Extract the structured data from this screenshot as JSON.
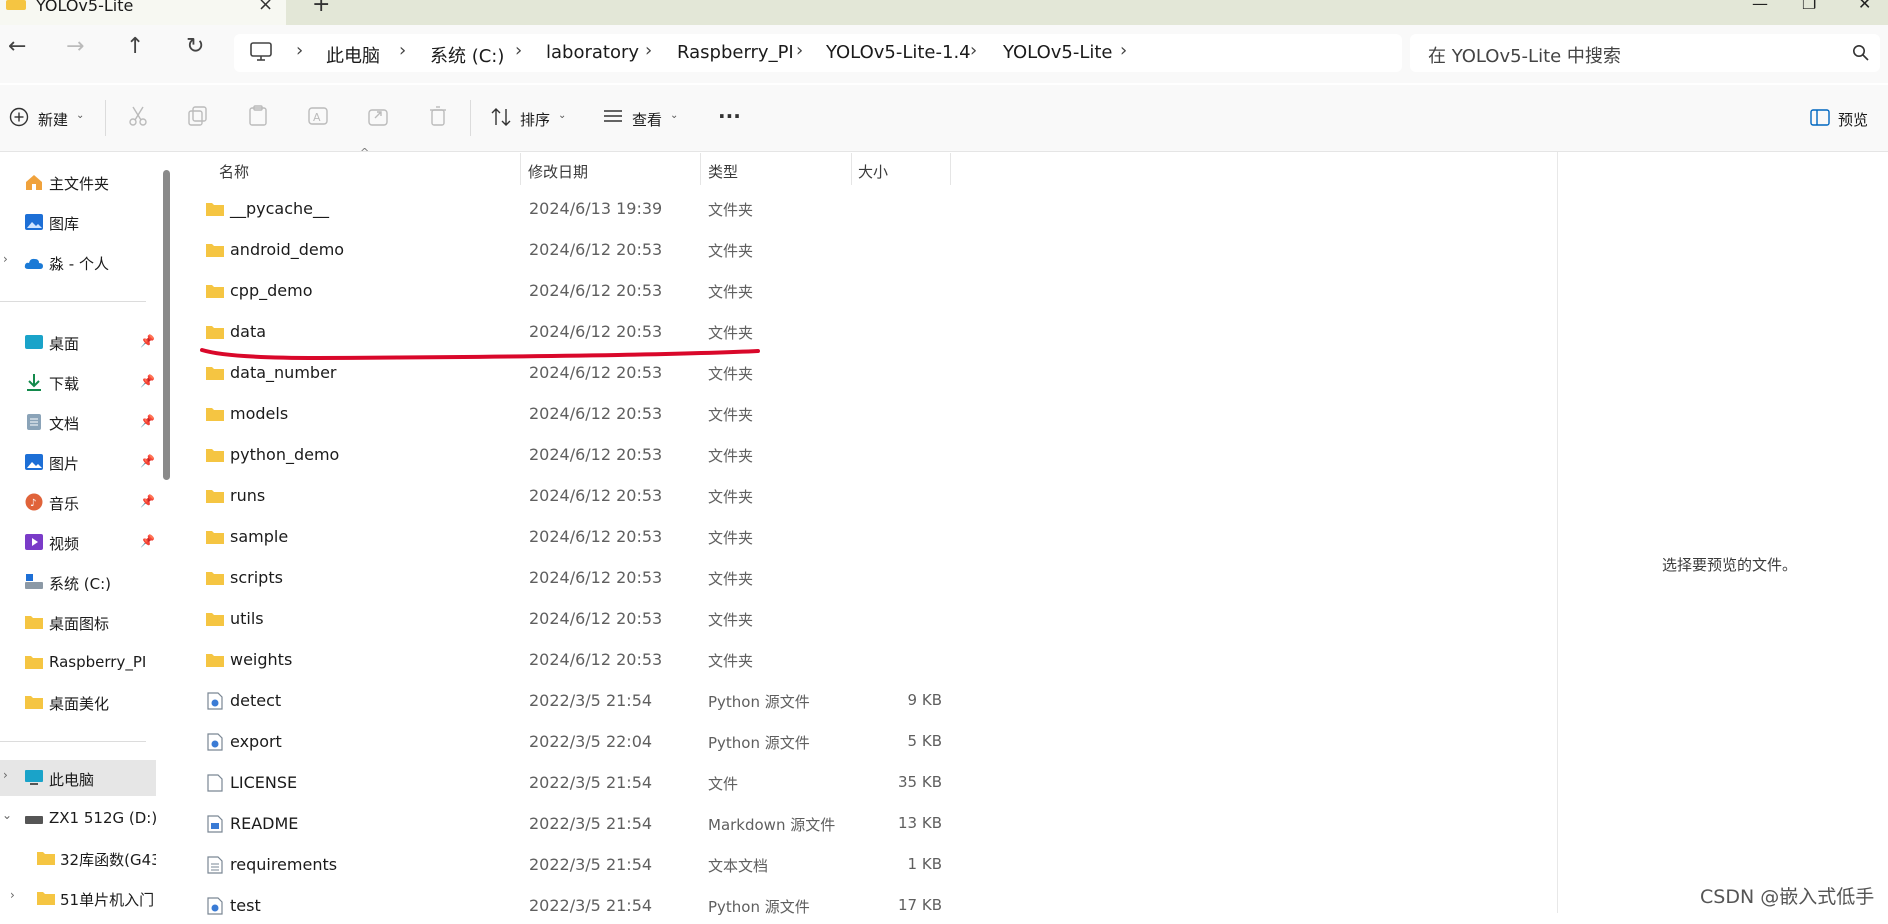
{
  "window": {
    "tab_title": "YOLOv5-Lite",
    "close_tab_symbol": "×",
    "new_tab_symbol": "+",
    "win_minimize": "—",
    "win_restore": "❐",
    "win_close": "✕"
  },
  "nav": {
    "back": "←",
    "forward": "→",
    "up": "↑",
    "refresh": "↻",
    "breadcrumbs": [
      "此电脑",
      "系统 (C:)",
      "laboratory",
      "Raspberry_PI",
      "YOLOv5-Lite-1.4",
      "YOLOv5-Lite"
    ],
    "sep": "›",
    "search_placeholder": "在 YOLOv5-Lite 中搜索"
  },
  "commandbar": {
    "new_label": "新建",
    "sort_label": "排序",
    "view_label": "查看",
    "more_label": "···",
    "preview_label": "预览"
  },
  "sidebar": {
    "quick": [
      {
        "label": "主文件夹",
        "icon": "home-icon"
      },
      {
        "label": "图库",
        "icon": "gallery-icon"
      },
      {
        "label": "淼 - 个人",
        "icon": "onedrive-icon"
      }
    ],
    "pinned": [
      {
        "label": "桌面",
        "icon": "desktop-icon"
      },
      {
        "label": "下载",
        "icon": "download-icon"
      },
      {
        "label": "文档",
        "icon": "document-icon"
      },
      {
        "label": "图片",
        "icon": "picture-icon"
      },
      {
        "label": "音乐",
        "icon": "music-icon"
      },
      {
        "label": "视频",
        "icon": "video-icon"
      }
    ],
    "folders": [
      {
        "label": "系统 (C:)",
        "icon": "drive-icon"
      },
      {
        "label": "桌面图标",
        "icon": "folder-icon"
      },
      {
        "label": "Raspberry_PI",
        "icon": "folder-icon"
      },
      {
        "label": "桌面美化",
        "icon": "folder-icon"
      }
    ],
    "this_pc": "此电脑",
    "drive_d": "ZX1 512G (D:)",
    "sub1": "32库函数(G43",
    "sub2": "51单片机入门"
  },
  "columns": {
    "name": "名称",
    "date": "修改日期",
    "type": "类型",
    "size": "大小"
  },
  "files": [
    {
      "name": "__pycache__",
      "date": "2024/6/13 19:39",
      "type": "文件夹",
      "size": "",
      "icon": "folder-icon"
    },
    {
      "name": "android_demo",
      "date": "2024/6/12 20:53",
      "type": "文件夹",
      "size": "",
      "icon": "folder-icon"
    },
    {
      "name": "cpp_demo",
      "date": "2024/6/12 20:53",
      "type": "文件夹",
      "size": "",
      "icon": "folder-icon"
    },
    {
      "name": "data",
      "date": "2024/6/12 20:53",
      "type": "文件夹",
      "size": "",
      "icon": "folder-icon"
    },
    {
      "name": "data_number",
      "date": "2024/6/12 20:53",
      "type": "文件夹",
      "size": "",
      "icon": "folder-icon"
    },
    {
      "name": "models",
      "date": "2024/6/12 20:53",
      "type": "文件夹",
      "size": "",
      "icon": "folder-icon"
    },
    {
      "name": "python_demo",
      "date": "2024/6/12 20:53",
      "type": "文件夹",
      "size": "",
      "icon": "folder-icon"
    },
    {
      "name": "runs",
      "date": "2024/6/12 20:53",
      "type": "文件夹",
      "size": "",
      "icon": "folder-icon"
    },
    {
      "name": "sample",
      "date": "2024/6/12 20:53",
      "type": "文件夹",
      "size": "",
      "icon": "folder-icon"
    },
    {
      "name": "scripts",
      "date": "2024/6/12 20:53",
      "type": "文件夹",
      "size": "",
      "icon": "folder-icon"
    },
    {
      "name": "utils",
      "date": "2024/6/12 20:53",
      "type": "文件夹",
      "size": "",
      "icon": "folder-icon"
    },
    {
      "name": "weights",
      "date": "2024/6/12 20:53",
      "type": "文件夹",
      "size": "",
      "icon": "folder-icon"
    },
    {
      "name": "detect",
      "date": "2022/3/5 21:54",
      "type": "Python 源文件",
      "size": "9 KB",
      "icon": "python-file-icon"
    },
    {
      "name": "export",
      "date": "2022/3/5 22:04",
      "type": "Python 源文件",
      "size": "5 KB",
      "icon": "python-file-icon"
    },
    {
      "name": "LICENSE",
      "date": "2022/3/5 21:54",
      "type": "文件",
      "size": "35 KB",
      "icon": "file-icon"
    },
    {
      "name": "README",
      "date": "2022/3/5 21:54",
      "type": "Markdown 源文件",
      "size": "13 KB",
      "icon": "markdown-file-icon"
    },
    {
      "name": "requirements",
      "date": "2022/3/5 21:54",
      "type": "文本文档",
      "size": "1 KB",
      "icon": "text-file-icon"
    },
    {
      "name": "test",
      "date": "2022/3/5 21:54",
      "type": "Python 源文件",
      "size": "17 KB",
      "icon": "python-file-icon"
    }
  ],
  "preview_text": "选择要预览的文件。",
  "watermark": "CSDN @嵌入式低手",
  "colors": {
    "folder": "#f5c542",
    "accent": "#0067c0",
    "annotation": "#d9082a"
  }
}
